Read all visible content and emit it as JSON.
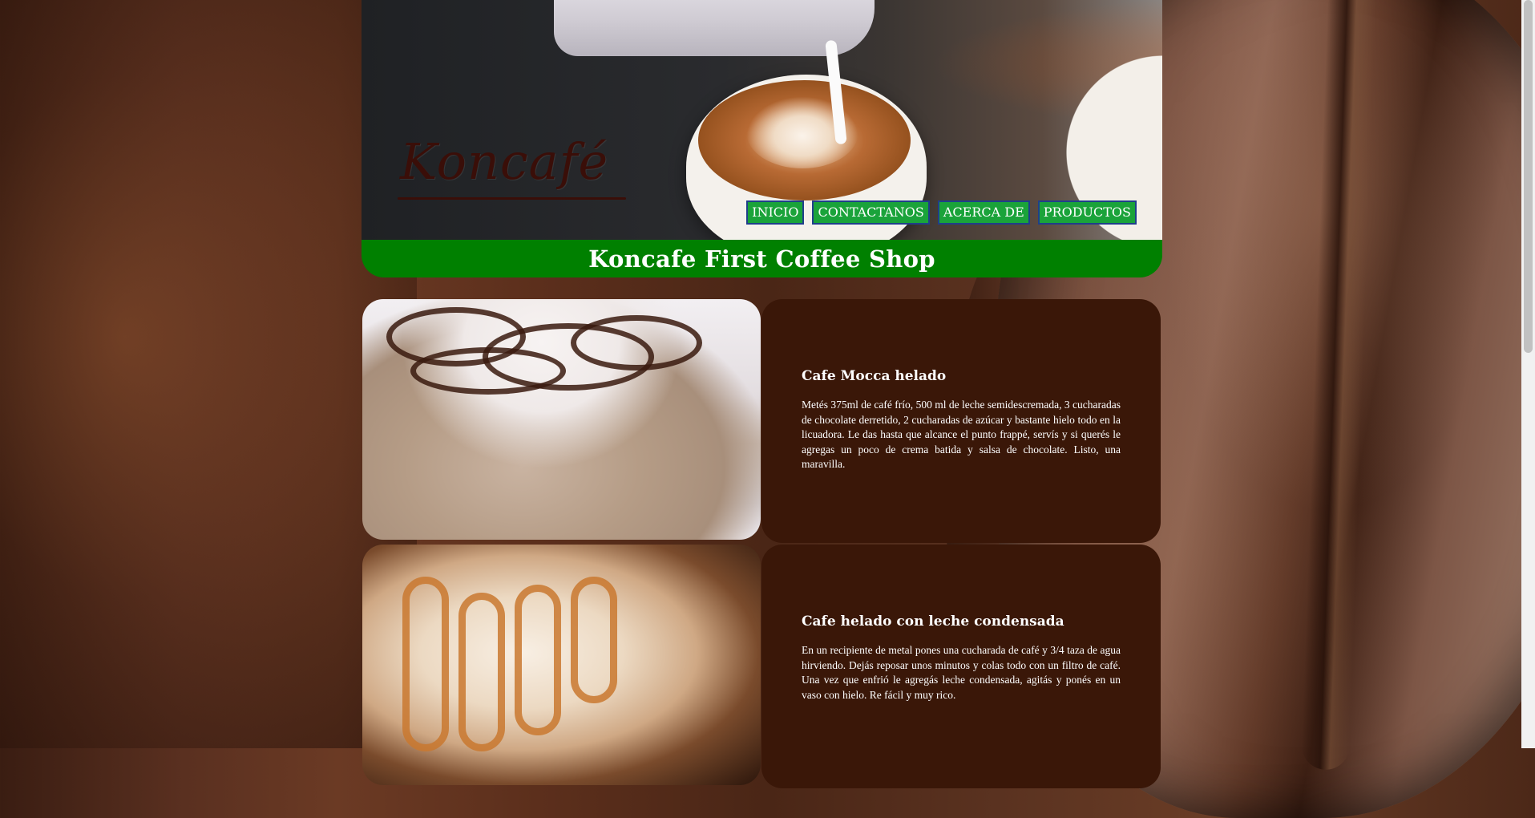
{
  "header": {
    "logo_text": "Koncafé",
    "nav": [
      {
        "label": "INICIO"
      },
      {
        "label": "CONTACTANOS"
      },
      {
        "label": "ACERCA DE"
      },
      {
        "label": "PRODUCTOS"
      }
    ],
    "site_title": "Koncafe First Coffee Shop"
  },
  "products": [
    {
      "name": "Cafe Mocca helado",
      "description": "Metés 375ml de café frío, 500 ml de leche semidescremada, 3 cucharadas de chocolate derretido, 2 cucharadas de azúcar y bastante hielo todo en la licuadora. Le das hasta que alcance el punto frappé, servís y si querés le agregas un poco de crema batida y salsa de chocolate. Listo, una maravilla."
    },
    {
      "name": "Cafe helado con leche condensada",
      "description": "En un recipiente de metal pones una cucharada de café y 3/4 taza de agua hirviendo. Dejás reposar unos minutos y colas todo con un filtro de café. Una vez que enfrió le agregás leche condensada, agitás y ponés en un vaso con hielo. Re fácil y muy rico."
    }
  ],
  "colors": {
    "title_bar": "#008000",
    "nav_button_bg": "#1aa33a",
    "nav_button_border": "#1f3f8a",
    "card_bg": "#3a1708"
  }
}
